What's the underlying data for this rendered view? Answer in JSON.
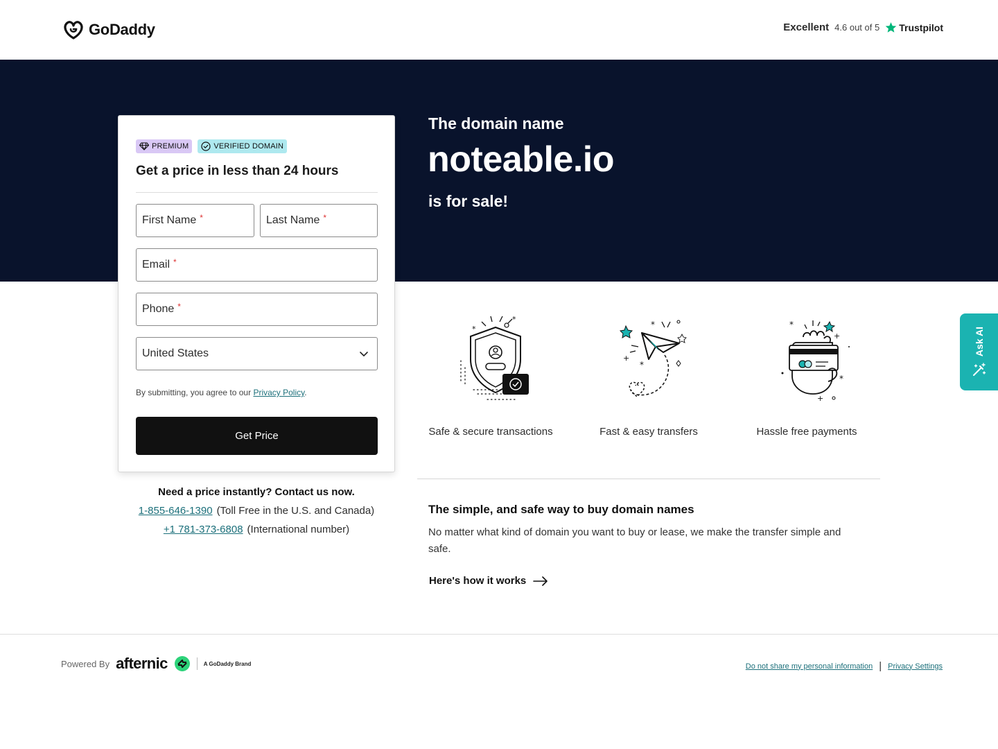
{
  "header": {
    "logo_text": "GoDaddy",
    "trust_rating_label": "Excellent",
    "trust_score": "4.6 out of 5",
    "trust_brand": "Trustpilot"
  },
  "hero": {
    "pre_title": "The domain name",
    "domain": "noteable.io",
    "post_title": "is for sale!"
  },
  "form": {
    "badge_premium": "PREMIUM",
    "badge_verified": "VERIFIED DOMAIN",
    "title": "Get a price in less than 24 hours",
    "first_name_placeholder": "First Name",
    "last_name_placeholder": "Last Name",
    "email_placeholder": "Email",
    "phone_placeholder": "Phone",
    "required_mark": "*",
    "country_value": "United States",
    "consent_text": "By submitting, you agree to our",
    "consent_link": "Privacy Policy",
    "consent_end": ".",
    "submit_label": "Get Price"
  },
  "contact": {
    "question": "Need a price instantly? Contact us now.",
    "phone_tollfree": "1-855-646-1390",
    "phone_tollfree_note": "(Toll Free in the U.S. and Canada)",
    "phone_intl": "+1 781-373-6808",
    "phone_intl_note": "(International number)"
  },
  "features": [
    {
      "label": "Safe & secure transactions",
      "icon": "shield-icon"
    },
    {
      "label": "Fast & easy transfers",
      "icon": "paper-plane-icon"
    },
    {
      "label": "Hassle free payments",
      "icon": "card-payment-icon"
    }
  ],
  "how": {
    "title": "The simple, and safe way to buy domain names",
    "description": "No matter what kind of domain you want to buy or lease, we make the transfer simple and safe.",
    "link": "Here's how it works"
  },
  "ask_ai": {
    "label": "Ask AI"
  },
  "footer": {
    "powered_by": "Powered By",
    "afternic": "afternic",
    "godaddy_brand": "A GoDaddy Brand",
    "link_do_not_share": "Do not share my personal information",
    "separator": "|",
    "link_privacy_settings": "Privacy Settings"
  },
  "colors": {
    "hero_bg": "#09132c",
    "accent_teal": "#1bb3b1",
    "link": "#1b6f7a",
    "button": "#111111",
    "badge_premium_bg": "#d9c8f5",
    "badge_verified_bg": "#aee9ef",
    "trustpilot_star": "#00b67a"
  }
}
